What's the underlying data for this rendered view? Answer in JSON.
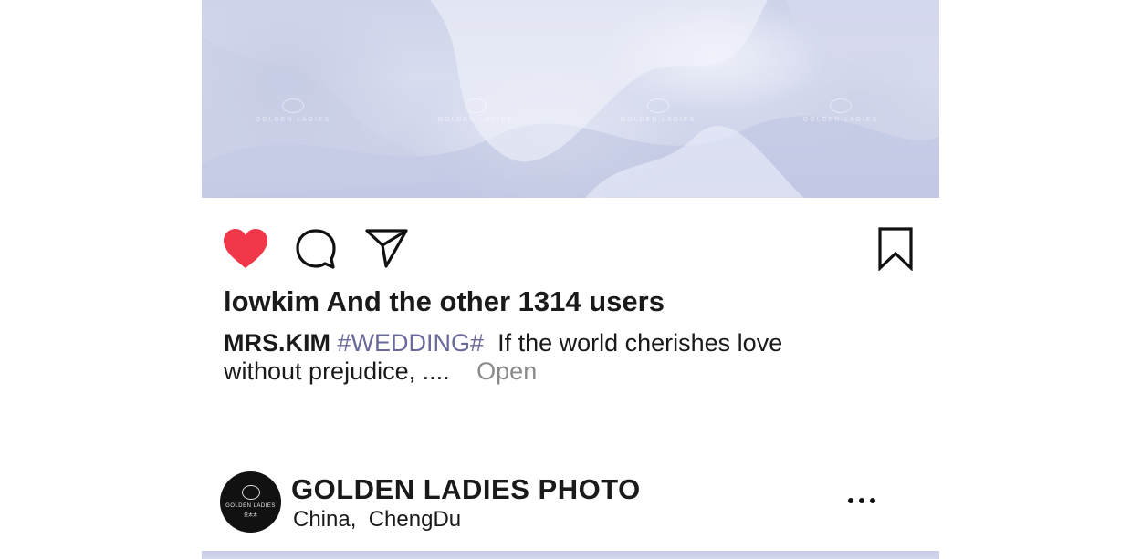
{
  "post": {
    "image_description_icon": "wedding-dress-photo",
    "watermark_text": "GOLDEN LADIES",
    "actions": {
      "like_icon": "heart-filled-icon",
      "comment_icon": "comment-bubble-icon",
      "share_icon": "send-paper-plane-icon",
      "save_icon": "bookmark-icon",
      "like_color": "#f0384a"
    },
    "likes_text": "lowkim And the other 1314 users",
    "caption": {
      "author": "MRS.KIM",
      "hashtag": "#WEDDING#",
      "text": "If the world cherishes love without prejudice, ....",
      "open_label": "Open"
    }
  },
  "next_post": {
    "avatar_text": "GOLDEN LADIES",
    "avatar_subtext": "金太太",
    "account_name": "GOLDEN LADIES PHOTO",
    "location_country": "China,",
    "location_city": "ChengDu",
    "more_icon": "more-dots-icon"
  }
}
